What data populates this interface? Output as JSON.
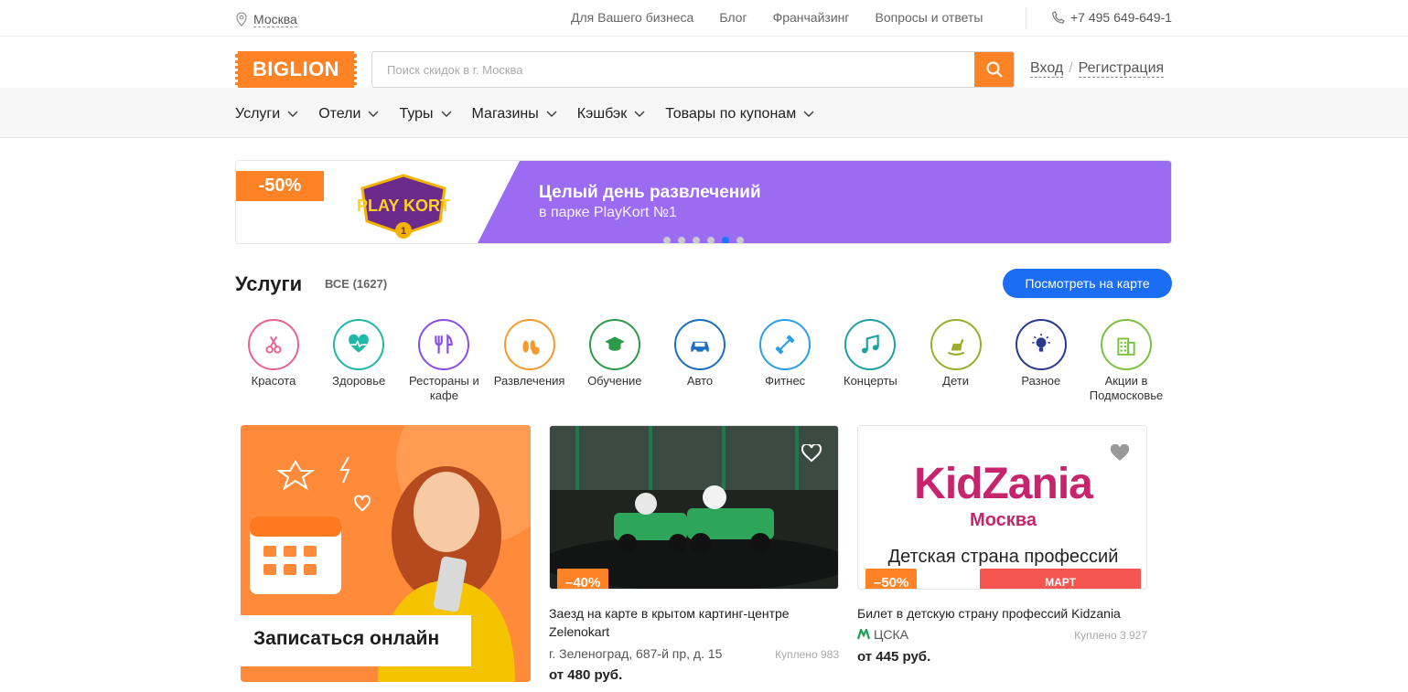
{
  "topbar": {
    "city": "Москва",
    "links": [
      "Для Вашего бизнеса",
      "Блог",
      "Франчайзинг",
      "Вопросы и ответы"
    ],
    "phone": "+7 495 649-649-1"
  },
  "header": {
    "logo": "BIGLION",
    "search_placeholder": "Поиск скидок в г. Москва",
    "login": "Вход",
    "separator": "/",
    "register": "Регистрация"
  },
  "nav": {
    "items": [
      "Услуги",
      "Отели",
      "Туры",
      "Магазины",
      "Кэшбэк",
      "Товары по купонам"
    ]
  },
  "banner": {
    "badge": "-50%",
    "logo_text": "PLAY KORT",
    "logo_number": "1",
    "title": "Целый день развлечений",
    "subtitle": "в парке PlayKort №1",
    "active_slide": 4,
    "slide_count": 6,
    "color": "#9b6bf2"
  },
  "section": {
    "title": "Услуги",
    "all_label": "ВСЕ (1627)",
    "map_button": "Посмотреть на карте"
  },
  "categories": [
    {
      "label": "Красота",
      "icon": "scissors-icon",
      "color": "#e8648c"
    },
    {
      "label": "Здоровье",
      "icon": "heart-pulse-icon",
      "color": "#20b8a6"
    },
    {
      "label": "Рестораны и кафе",
      "icon": "cutlery-icon",
      "color": "#8a4fe6"
    },
    {
      "label": "Развлечения",
      "icon": "bowling-icon",
      "color": "#f59a2e"
    },
    {
      "label": "Обучение",
      "icon": "graduation-cap-icon",
      "color": "#2e9a4a"
    },
    {
      "label": "Авто",
      "icon": "car-icon",
      "color": "#1b6ec2"
    },
    {
      "label": "Фитнес",
      "icon": "dumbbell-icon",
      "color": "#2aa0e8"
    },
    {
      "label": "Концерты",
      "icon": "music-note-icon",
      "color": "#1fa1a1"
    },
    {
      "label": "Дети",
      "icon": "rocking-horse-icon",
      "color": "#9cac2b"
    },
    {
      "label": "Разное",
      "icon": "lightbulb-icon",
      "color": "#2b3a8f"
    },
    {
      "label": "Акции в Подмосковье",
      "icon": "building-icon",
      "color": "#7bc043"
    }
  ],
  "promo": {
    "text": "Записаться онлайн"
  },
  "cards": [
    {
      "discount": "–40%",
      "title": "Заезд на карте в крытом картинг-центре Zelenokart",
      "location": "г. Зеленоград, 687-й пр, д. 15",
      "bought": "Куплено 983",
      "price": "от 480 руб."
    },
    {
      "discount": "–50%",
      "metro_tag": "МАРТ",
      "image_brand": "KidZania",
      "image_city": "Москва",
      "image_caption": "Детская страна профессий",
      "title": "Билет в детскую страну профессий Kidzania",
      "location": "ЦСКА",
      "bought": "Куплено 3 927",
      "price": "от 445 руб."
    }
  ]
}
